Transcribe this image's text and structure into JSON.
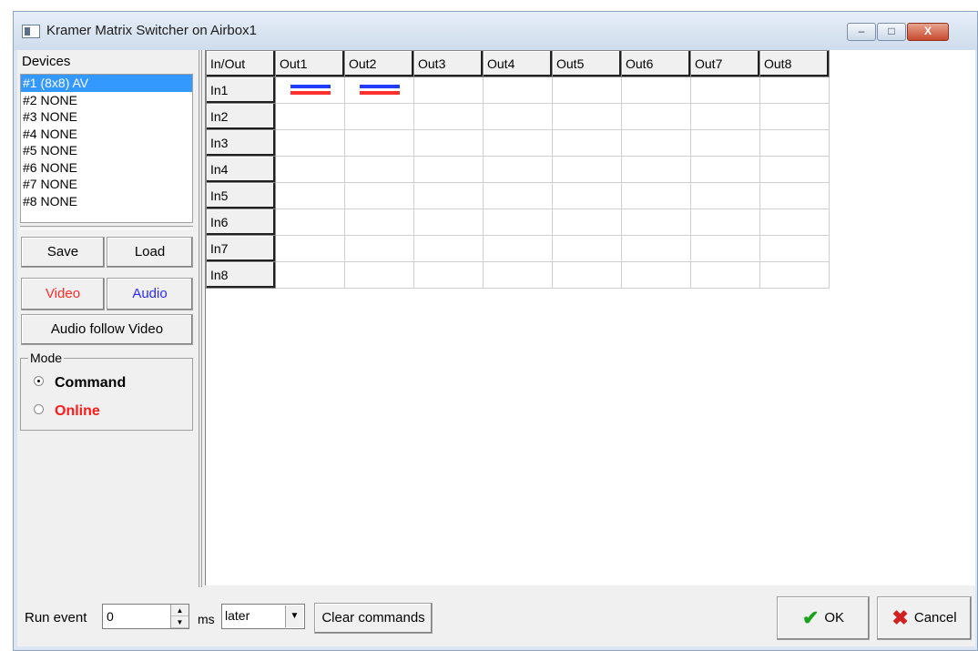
{
  "window": {
    "title": "Kramer Matrix Switcher on Airbox1",
    "minimize_glyph": "–",
    "maximize_glyph": "□",
    "close_glyph": "X"
  },
  "devices": {
    "label": "Devices",
    "items": [
      "#1 (8x8) AV",
      "#2 NONE",
      "#3 NONE",
      "#4 NONE",
      "#5 NONE",
      "#6 NONE",
      "#7 NONE",
      "#8 NONE"
    ],
    "selected_index": 0
  },
  "buttons": {
    "save": "Save",
    "load": "Load",
    "video": "Video",
    "audio": "Audio",
    "audio_follow_video": "Audio follow Video"
  },
  "mode": {
    "legend": "Mode",
    "options": [
      "Command",
      "Online"
    ],
    "selected": "Command"
  },
  "matrix": {
    "corner": "In/Out",
    "outputs": [
      "Out1",
      "Out2",
      "Out3",
      "Out4",
      "Out5",
      "Out6",
      "Out7",
      "Out8"
    ],
    "inputs": [
      "In1",
      "In2",
      "In3",
      "In4",
      "In5",
      "In6",
      "In7",
      "In8"
    ],
    "routes": [
      {
        "input": "In1",
        "output": "Out1",
        "video": true,
        "audio": true
      },
      {
        "input": "In1",
        "output": "Out2",
        "video": true,
        "audio": true
      }
    ]
  },
  "bottom": {
    "run_event_label": "Run event",
    "run_event_value": "0",
    "ms_label": "ms",
    "timing_value": "later",
    "clear_commands": "Clear commands",
    "ok": "OK",
    "cancel": "Cancel"
  },
  "colors": {
    "video": "#ff2a2a",
    "audio": "#2a2aff",
    "selection": "#3399ff",
    "online": "#ff1a1a"
  }
}
